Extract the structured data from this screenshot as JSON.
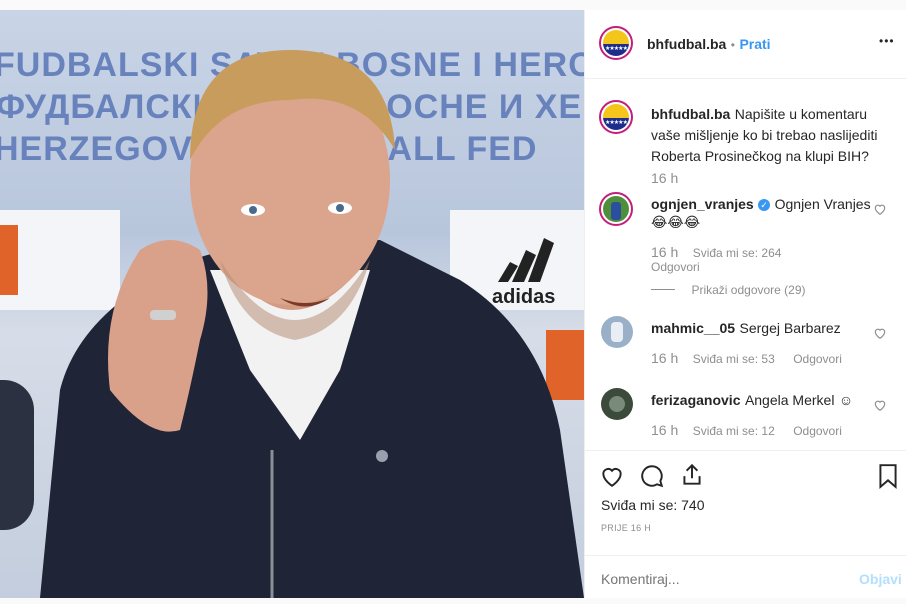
{
  "post": {
    "author": "bhfudbal.ba",
    "follow_label": "Prati",
    "separator": "•",
    "more_label": "•••"
  },
  "photo": {
    "banner_lines": [
      "FUDBALSKI SAVEZ BOSNE I HERCEG",
      "ФУДБАЛСКИ САВЕЗ БОСНЕ И ХЕ",
      "HERZEGOVINA FOOTBALL FED"
    ],
    "sponsor": "adidas",
    "bg_color": "#b8c6dc"
  },
  "caption": {
    "author": "bhfudbal.ba",
    "text_line1": "Napišite u komentaru",
    "text_line2": "vaše mišljenje ko bi trebao naslijediti",
    "text_line3": "Roberta Prosinečkog na klupi BIH?",
    "time": "16 h"
  },
  "comments": [
    {
      "user": "ognjen_vranjes",
      "text": "Ognjen Vranjes",
      "emoji": "😂😂😂",
      "time": "16 h",
      "likes": "Sviđa mi se: 264",
      "reply": "Odgovori",
      "view_replies": "Prikaži odgovore (29)"
    },
    {
      "user": "mahmic__05",
      "text": "Sergej Barbarez",
      "time": "16 h",
      "likes": "Sviđa mi se: 53",
      "reply": "Odgovori"
    },
    {
      "user": "ferizaganovic",
      "text": "Angela Merkel",
      "emoji": "☺",
      "time": "16 h",
      "likes": "Sviđa mi se: 12",
      "reply": "Odgovori"
    }
  ],
  "actions": {
    "likes": "Sviđa mi se: 740",
    "timestamp": "PRIJE 16 H"
  },
  "comment_input": {
    "placeholder": "Komentiraj...",
    "post_label": "Objavi"
  },
  "colors": {
    "link": "#3897f0",
    "ring": "#c21e7a",
    "muted": "#8e8e8e"
  }
}
